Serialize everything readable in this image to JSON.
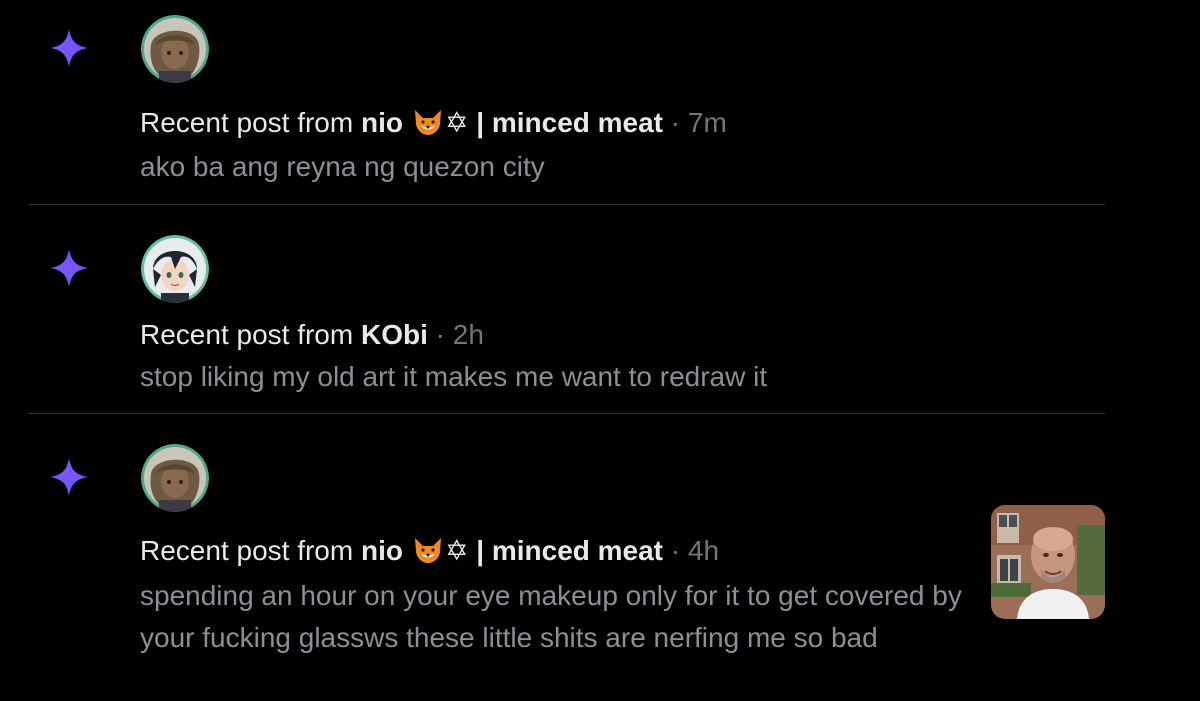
{
  "notifications": [
    {
      "prefix": "Recent post from ",
      "author": "nio",
      "emoji_fox": "🦊",
      "author_suffix": "✡︎ | minced meat",
      "separator": " · ",
      "time": "7m",
      "preview": "ako ba ang reyna ng quezon city",
      "avatar": "anime-avatar-brown-hair-icon",
      "has_thumbnail": false
    },
    {
      "prefix": "Recent post from ",
      "author": "KObi",
      "separator": " · ",
      "time": "2h",
      "preview": "stop liking my old art it makes me want to redraw it",
      "avatar": "anime-avatar-dark-hair-icon",
      "has_thumbnail": false
    },
    {
      "prefix": "Recent post from ",
      "author": "nio",
      "emoji_fox": "🦊",
      "author_suffix": "✡︎ | minced meat",
      "separator": " · ",
      "time": "4h",
      "preview": "spending an hour on your eye makeup only for it to get covered by your fucking glassws these little shits are nerfing me so bad",
      "avatar": "anime-avatar-brown-hair-icon",
      "has_thumbnail": true,
      "thumbnail": "bald-man-photo"
    }
  ],
  "colors": {
    "background": "#000000",
    "sparkle": "#7856ff",
    "primary_text": "#e7e9ea",
    "secondary_text": "#71767b",
    "preview_text": "#8b9096",
    "divider": "#2f3336"
  },
  "icons": {
    "sparkle": "sparkle-icon",
    "fox_emoji": "fox-emoji-icon"
  }
}
